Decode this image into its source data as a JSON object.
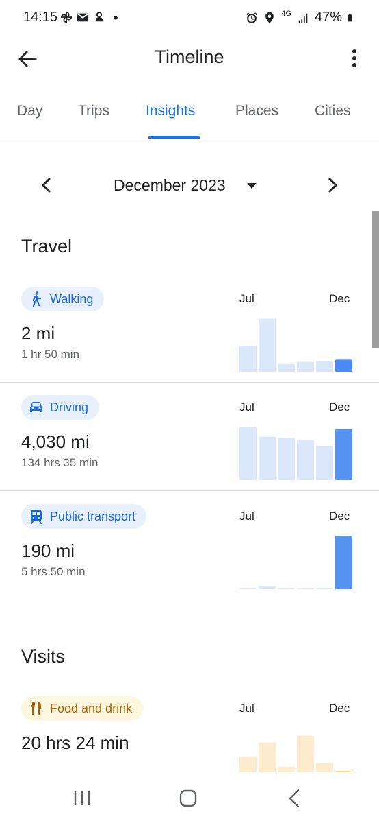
{
  "status_bar": {
    "time": "14:15",
    "network": "4G",
    "battery": "47%",
    "left_icons": [
      "pinwheel-icon",
      "mail-icon",
      "notification-icon",
      "dot-icon"
    ],
    "right_icons": [
      "alarm-icon",
      "location-icon",
      "signal-icon",
      "battery-icon"
    ]
  },
  "app_bar": {
    "title": "Timeline",
    "back_icon": "arrow-back-icon",
    "more_icon": "more-vert-icon"
  },
  "tabs": [
    {
      "label": "Day",
      "active": false
    },
    {
      "label": "Trips",
      "active": false
    },
    {
      "label": "Insights",
      "active": true
    },
    {
      "label": "Places",
      "active": false
    },
    {
      "label": "Cities",
      "active": false
    }
  ],
  "month_selector": {
    "label": "December 2023",
    "prev_icon": "chevron-left-icon",
    "next_icon": "chevron-right-icon",
    "dropdown_icon": "caret-down-icon"
  },
  "sections": {
    "travel": {
      "title": "Travel",
      "items": [
        {
          "label": "Walking",
          "icon": "walking-icon",
          "value": "2 mi",
          "sub": "1 hr 50 min",
          "axis_start": "Jul",
          "axis_end": "Dec",
          "bar_fractions": [
            0.47,
            0.97,
            0.14,
            0.18,
            0.2,
            0.22
          ],
          "color_light": "#dbe8fb",
          "color_current": "#4a8af4"
        },
        {
          "label": "Driving",
          "icon": "car-icon",
          "value": "4,030 mi",
          "sub": "134 hrs 35 min",
          "axis_start": "Jul",
          "axis_end": "Dec",
          "bar_fractions": [
            0.97,
            0.79,
            0.77,
            0.73,
            0.62,
            0.93
          ],
          "color_light": "#dbe8fb",
          "color_current": "#5794f2"
        },
        {
          "label": "Public transport",
          "icon": "transit-icon",
          "value": "190 mi",
          "sub": "5 hrs 50 min",
          "axis_start": "Jul",
          "axis_end": "Dec",
          "bar_fractions": [
            0.01,
            0.06,
            0.01,
            0.01,
            0.01,
            0.97
          ],
          "color_light": "#dbe8fb",
          "color_current": "#5794f2"
        }
      ]
    },
    "visits": {
      "title": "Visits",
      "items": [
        {
          "label": "Food and drink",
          "icon": "restaurant-icon",
          "value": "20 hrs 24 min",
          "axis_start": "Jul",
          "axis_end": "Dec",
          "bar_fractions": [
            0.44,
            0.7,
            0.26,
            0.83,
            0.33,
            0.18
          ],
          "color_light": "#fdebce",
          "color_current": "#f29900"
        }
      ]
    }
  },
  "nav_bar": {
    "recents_icon": "recents-icon",
    "home_icon": "home-icon",
    "back_icon": "nav-back-icon"
  }
}
